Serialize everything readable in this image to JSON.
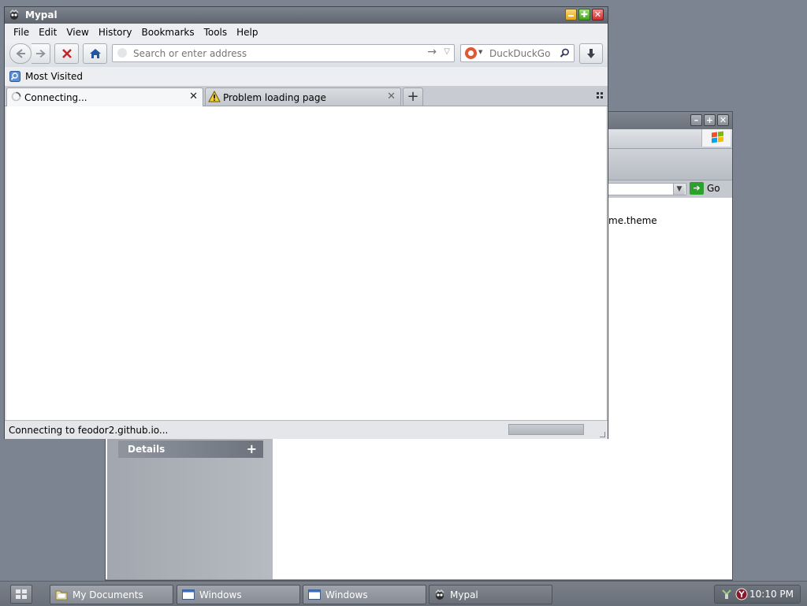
{
  "background_window": {
    "go_label": "Go",
    "content_text": "me.theme",
    "details_label": "Details",
    "details_plus": "+"
  },
  "window": {
    "title": "Mypal",
    "menu": [
      {
        "label": "File"
      },
      {
        "label": "Edit"
      },
      {
        "label": "View"
      },
      {
        "label": "History"
      },
      {
        "label": "Bookmarks"
      },
      {
        "label": "Tools"
      },
      {
        "label": "Help"
      }
    ],
    "urlbar": {
      "placeholder": "Search or enter address"
    },
    "search": {
      "placeholder": "DuckDuckGo"
    },
    "bookmarks_toolbar": {
      "most_visited": "Most Visited"
    },
    "tabs": [
      {
        "label": "Connecting...",
        "close": "✕",
        "state": "loading"
      },
      {
        "label": "Problem loading page",
        "close": "✕",
        "state": "warning"
      }
    ],
    "new_tab": "+",
    "status": "Connecting to feodor2.github.io..."
  },
  "taskbar": {
    "items": [
      {
        "label": "My Documents",
        "icon": "folder-icon"
      },
      {
        "label": "Windows",
        "icon": "window-icon"
      },
      {
        "label": "Windows",
        "icon": "window-icon"
      },
      {
        "label": "Mypal",
        "icon": "mypal-icon"
      }
    ],
    "clock": "10:10 PM"
  },
  "colors": {
    "desktop": "#7d8491",
    "close_red": "#d22e2e",
    "min_yellow": "#e7a51c",
    "max_green": "#43a11c"
  }
}
